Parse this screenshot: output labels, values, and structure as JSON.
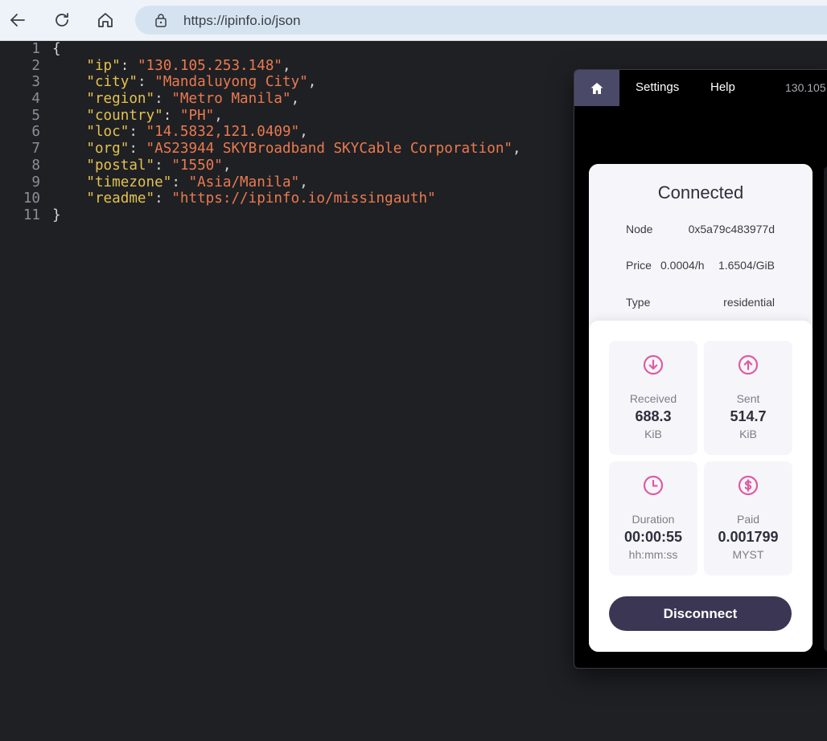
{
  "browser": {
    "url": "https://ipinfo.io/json"
  },
  "json_view": {
    "lines": [
      {
        "num": "1",
        "key": "",
        "value": "",
        "prefix": "{",
        "suffix": ""
      },
      {
        "num": "2",
        "key": "\"ip\"",
        "value": "\"130.105.253.148\"",
        "prefix": "",
        "suffix": ","
      },
      {
        "num": "3",
        "key": "\"city\"",
        "value": "\"Mandaluyong City\"",
        "prefix": "",
        "suffix": ","
      },
      {
        "num": "4",
        "key": "\"region\"",
        "value": "\"Metro Manila\"",
        "prefix": "",
        "suffix": ","
      },
      {
        "num": "5",
        "key": "\"country\"",
        "value": "\"PH\"",
        "prefix": "",
        "suffix": ","
      },
      {
        "num": "6",
        "key": "\"loc\"",
        "value": "\"14.5832,121.0409\"",
        "prefix": "",
        "suffix": ","
      },
      {
        "num": "7",
        "key": "\"org\"",
        "value": "\"AS23944 SKYBroadband SKYCable Corporation\"",
        "prefix": "",
        "suffix": ","
      },
      {
        "num": "8",
        "key": "\"postal\"",
        "value": "\"1550\"",
        "prefix": "",
        "suffix": ","
      },
      {
        "num": "9",
        "key": "\"timezone\"",
        "value": "\"Asia/Manila\"",
        "prefix": "",
        "suffix": ","
      },
      {
        "num": "10",
        "key": "\"readme\"",
        "value": "\"https://ipinfo.io/missingauth\"",
        "prefix": "",
        "suffix": ""
      },
      {
        "num": "11",
        "key": "",
        "value": "",
        "prefix": "}",
        "suffix": ""
      }
    ],
    "colors": {
      "key": "#e2c24f",
      "string": "#ea7a4f",
      "punct": "#d6d6d6"
    }
  },
  "app": {
    "nav": {
      "settings": "Settings",
      "help": "Help",
      "ip": "130.105"
    },
    "status": "Connected",
    "details": {
      "node_label": "Node",
      "node_value": "0x5a79c483977d",
      "price_label": "Price",
      "price_hour": "0.0004/h",
      "price_gib": "1.6504/GiB",
      "type_label": "Type",
      "type_value": "residential"
    },
    "stats": {
      "received": {
        "label": "Received",
        "value": "688.3",
        "unit": "KiB",
        "icon": "arrow-down-circle-icon"
      },
      "sent": {
        "label": "Sent",
        "value": "514.7",
        "unit": "KiB",
        "icon": "arrow-up-circle-icon"
      },
      "duration": {
        "label": "Duration",
        "value": "00:00:55",
        "unit": "hh:mm:ss",
        "icon": "clock-icon"
      },
      "paid": {
        "label": "Paid",
        "value": "0.001799",
        "unit": "MYST",
        "icon": "dollar-circle-icon"
      }
    },
    "disconnect_label": "Disconnect",
    "colors": {
      "accent": "#e05aa3",
      "button": "#3b3654",
      "nav_active": "#4a4a68"
    }
  }
}
